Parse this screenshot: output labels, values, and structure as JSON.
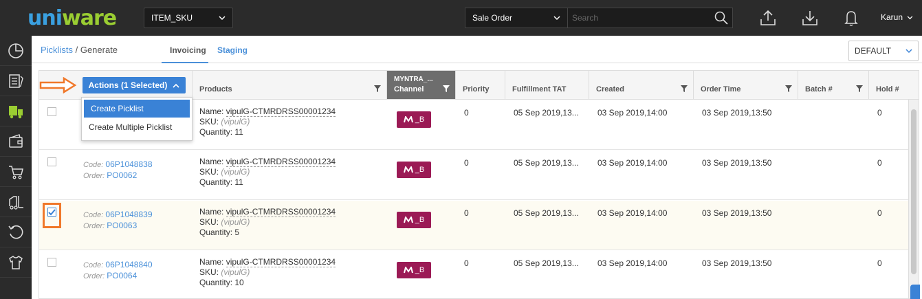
{
  "brand": {
    "logo_u": "uni",
    "logo_ware": "ware"
  },
  "topbar": {
    "sku_select": "ITEM_SKU",
    "search_type": "Sale Order",
    "search_placeholder": "Search",
    "user": "Karun"
  },
  "breadcrumb": {
    "parent": "Picklists",
    "sep": "/",
    "current": "Generate"
  },
  "tabs": {
    "invoicing": "Invoicing",
    "staging": "Staging"
  },
  "view_select": "DEFAULT",
  "grid": {
    "actions_label": "Actions (1 Selected)",
    "headers": {
      "products": "Products",
      "channel_top": "MYNTRA_...",
      "channel": "Channel",
      "priority": "Priority",
      "tat": "Fulfillment TAT",
      "created": "Created",
      "order_time": "Order Time",
      "batch": "Batch #",
      "hold": "Hold #"
    },
    "dropdown": [
      "Create Picklist",
      "Create Multiple Picklist"
    ],
    "labels": {
      "code": "Code:",
      "order": "Order:",
      "name": "Name:",
      "sku": "SKU:",
      "quantity": "Quantity:"
    },
    "rows": [
      {
        "code": "",
        "order": "",
        "name": "vipulG-CTMRDRSS00001234",
        "sku": "(vipulG)",
        "qty": "11",
        "channel": "_B",
        "priority": "0",
        "tat": "05 Sep 2019,13...",
        "created": "03 Sep 2019,14:00",
        "order_time": "03 Sep 2019,13:50",
        "batch": "",
        "hold": "0",
        "checked": false
      },
      {
        "code": "06P1048838",
        "order": "PO0062",
        "name": "vipulG-CTMRDRSS00001234",
        "sku": "(vipulG)",
        "qty": "11",
        "channel": "_B",
        "priority": "0",
        "tat": "05 Sep 2019,13...",
        "created": "03 Sep 2019,14:00",
        "order_time": "03 Sep 2019,13:50",
        "batch": "",
        "hold": "0",
        "checked": false
      },
      {
        "code": "06P1048839",
        "order": "PO0063",
        "name": "vipulG-CTMRDRSS00001234",
        "sku": "(vipulG)",
        "qty": "5",
        "channel": "_B",
        "priority": "0",
        "tat": "05 Sep 2019,13...",
        "created": "03 Sep 2019,14:00",
        "order_time": "03 Sep 2019,13:50",
        "batch": "",
        "hold": "0",
        "checked": true
      },
      {
        "code": "06P1048840",
        "order": "PO0064",
        "name": "vipulG-CTMRDRSS00001234",
        "sku": "(vipulG)",
        "qty": "10",
        "channel": "_B",
        "priority": "0",
        "tat": "05 Sep 2019,13...",
        "created": "03 Sep 2019,14:00",
        "order_time": "03 Sep 2019,13:50",
        "batch": "",
        "hold": "0",
        "checked": false
      }
    ]
  },
  "colors": {
    "accent": "#3a82d6",
    "channel_badge": "#9b1a55",
    "highlight": "#f0782a"
  }
}
